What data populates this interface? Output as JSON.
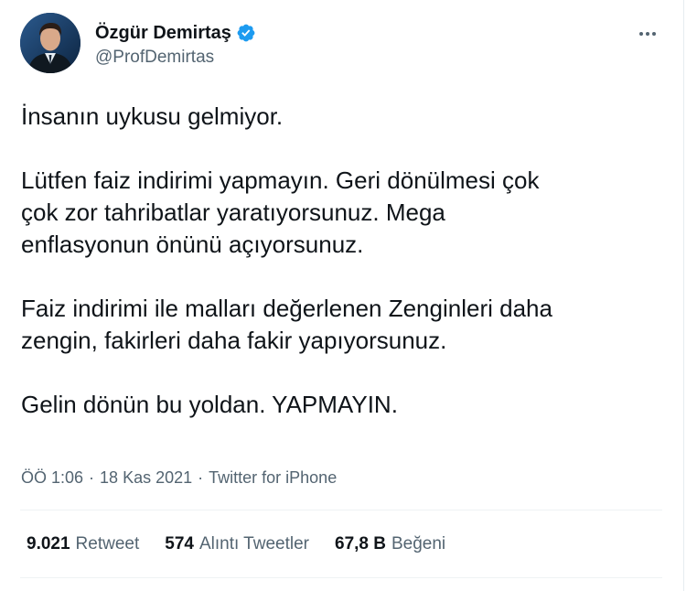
{
  "author": {
    "name": "Özgür Demirtaş",
    "handle": "@ProfDemirtas"
  },
  "tweet": {
    "paragraphs": [
      [
        "İnsanın uykusu gelmiyor."
      ],
      [
        "Lütfen faiz indirimi yapmayın. Geri dönülmesi çok",
        "çok zor tahribatlar yaratıyorsunuz. Mega",
        "enflasyonun önünü açıyorsunuz."
      ],
      [
        "Faiz indirimi ile malları değerlenen Zenginleri daha",
        "zengin, fakirleri daha fakir yapıyorsunuz."
      ],
      [
        "Gelin dönün bu yoldan. YAPMAYIN."
      ]
    ],
    "time": "ÖÖ 1:06",
    "date": "18 Kas 2021",
    "source": "Twitter for iPhone",
    "separator": "·"
  },
  "stats": [
    {
      "value": "9.021",
      "label": "Retweet"
    },
    {
      "value": "574",
      "label": "Alıntı Tweetler"
    },
    {
      "value": "67,8 B",
      "label": "Beğeni"
    }
  ],
  "colors": {
    "verified": "#1d9bf0",
    "secondary_text": "#536471",
    "primary_text": "#0f1419",
    "divider": "#eff3f4"
  },
  "icons": {
    "verified": "verified-badge-icon",
    "more": "more-options-icon"
  }
}
